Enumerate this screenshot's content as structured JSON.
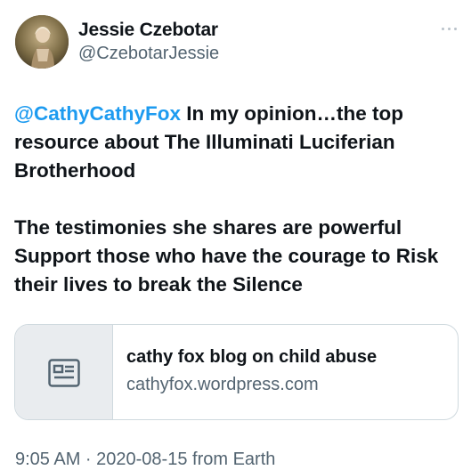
{
  "author": {
    "name": "Jessie Czebotar",
    "handle": "@CzebotarJessie",
    "avatar_icon": "profile-photo"
  },
  "menu_icon": "more-horizontal-icon",
  "tweet": {
    "mention": "@CathyCathyFox",
    "line1_rest": " In my opinion…the top resource about The Illuminati Luciferian Brotherhood",
    "paragraph2": "The testimonies she shares are powerful Support those who have the courage to Risk their lives to break the Silence"
  },
  "link_card": {
    "title": "cathy fox blog on child abuse",
    "domain": "cathyfox.wordpress.com",
    "icon": "article-icon"
  },
  "timestamp": "9:05 AM · 2020-08-15 from Earth",
  "colors": {
    "mention": "#1d9bf0",
    "secondary_text": "#536471",
    "border": "#cfd9de",
    "card_media_bg": "#e9ecef"
  }
}
